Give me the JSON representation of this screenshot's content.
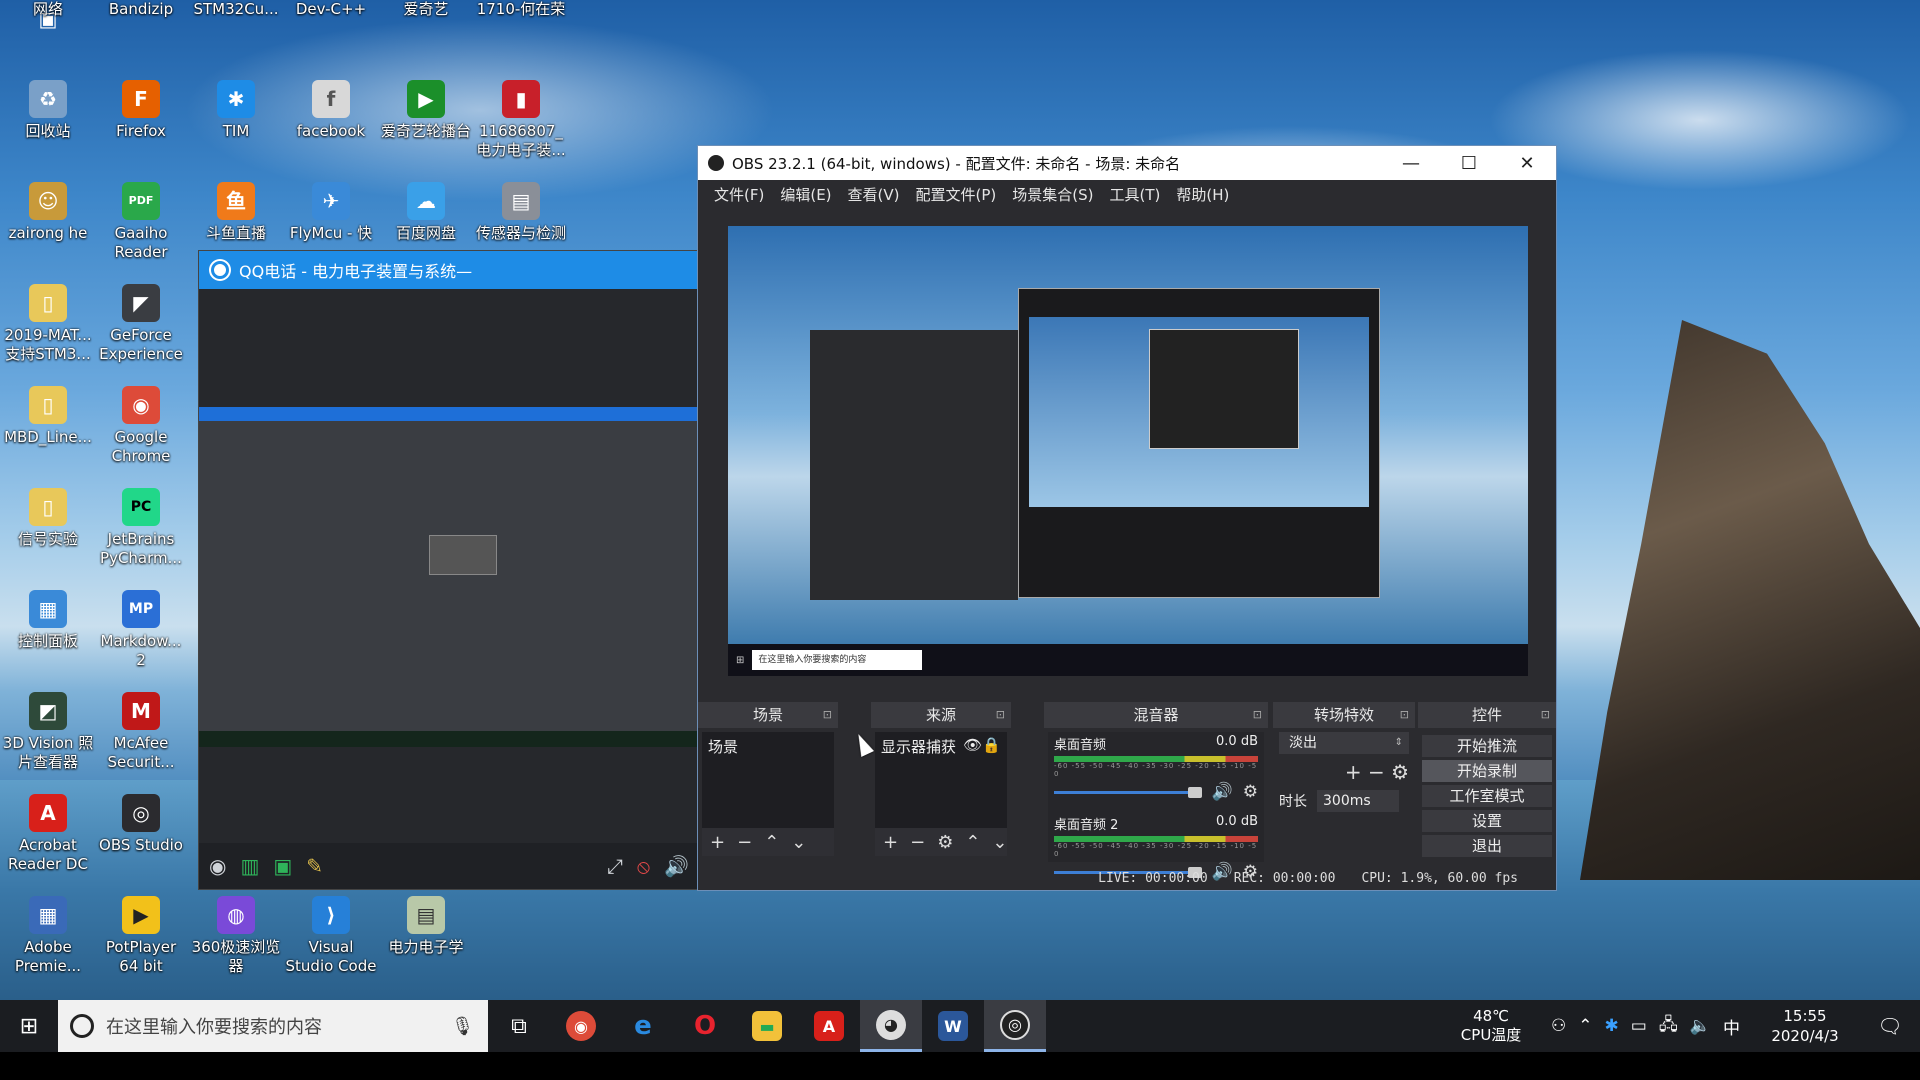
{
  "desktop": {
    "icons": [
      {
        "label": "网络",
        "glyph": "▣",
        "color": "#3a7bd5"
      },
      {
        "label": "Bandizip",
        "glyph": "B",
        "color": "#2f80ed"
      },
      {
        "label": "STM32Cu...",
        "glyph": "S",
        "color": "#2f5fa8"
      },
      {
        "label": "Dev-C++",
        "glyph": "C",
        "color": "#2a55a5"
      },
      {
        "label": "爱奇艺",
        "glyph": "爱",
        "color": "#2fb43a"
      },
      {
        "label": "1710-何在荣",
        "glyph": "W",
        "color": "#2b579a"
      },
      {
        "label": "回收站",
        "glyph": "♻",
        "color": "#7aa0c8"
      },
      {
        "label": "Firefox",
        "glyph": "F",
        "color": "#e66000"
      },
      {
        "label": "TIM",
        "glyph": "✱",
        "color": "#1e8ce6"
      },
      {
        "label": "facebook",
        "glyph": "f",
        "color": "#d8d8d8"
      },
      {
        "label": "爱奇艺轮播台",
        "glyph": "▶",
        "color": "#1b8f2a"
      },
      {
        "label": "11686807_电力电子装...",
        "glyph": "▮",
        "color": "#c8202a"
      },
      {
        "label": "zairong he",
        "glyph": "☺",
        "color": "#c89a3a"
      },
      {
        "label": "Gaaiho Reader",
        "glyph": "PDF",
        "color": "#2aa84a"
      },
      {
        "label": "斗鱼直播",
        "glyph": "鱼",
        "color": "#f07a1a"
      },
      {
        "label": "FlyMcu - 快",
        "glyph": "✈",
        "color": "#3a8ad8"
      },
      {
        "label": "百度网盘",
        "glyph": "☁",
        "color": "#3aa0e8"
      },
      {
        "label": "传感器与检测",
        "glyph": "▤",
        "color": "#8a8f98"
      },
      {
        "label": "2019-MAT... 支持STM3...",
        "glyph": "▯",
        "color": "#e8c85a"
      },
      {
        "label": "GeForce Experience",
        "glyph": "◤",
        "color": "#3a3d42"
      },
      {
        "label": "MBD_Line...",
        "glyph": "▯",
        "color": "#e8c85a"
      },
      {
        "label": "Google Chrome",
        "glyph": "◉",
        "color": "#dd4b39"
      },
      {
        "label": "信号实验",
        "glyph": "▯",
        "color": "#e8c85a"
      },
      {
        "label": "JetBrains PyCharm...",
        "glyph": "PC",
        "color": "#21d789"
      },
      {
        "label": "控制面板",
        "glyph": "▦",
        "color": "#3a8ad8"
      },
      {
        "label": "Markdow... 2",
        "glyph": "MP",
        "color": "#2b6fd6"
      },
      {
        "label": "3D Vision 照片查看器",
        "glyph": "◩",
        "color": "#2e4a3a"
      },
      {
        "label": "McAfee Securit...",
        "glyph": "M",
        "color": "#c01818"
      },
      {
        "label": "Acrobat Reader DC",
        "glyph": "A",
        "color": "#d8201a"
      },
      {
        "label": "OBS Studio",
        "glyph": "◎",
        "color": "#2b2b2f"
      },
      {
        "label": "Adobe Premie...",
        "glyph": "▦",
        "color": "#3a6ab8"
      },
      {
        "label": "PotPlayer 64 bit",
        "glyph": "▶",
        "color": "#f2c11a"
      },
      {
        "label": "360极速浏览器",
        "glyph": "◍",
        "color": "#7a4ad8"
      },
      {
        "label": "Visual Studio Code",
        "glyph": "⟩",
        "color": "#2680d8"
      },
      {
        "label": "电力电子学",
        "glyph": "▤",
        "color": "#b8c8a8"
      }
    ]
  },
  "qq_window": {
    "title": "QQ电话 - 电力电子装置与系统—"
  },
  "obs": {
    "title": "OBS 23.2.1 (64-bit, windows) - 配置文件: 未命名 - 场景: 未命名",
    "menu": [
      "文件(F)",
      "编辑(E)",
      "查看(V)",
      "配置文件(P)",
      "场景集合(S)",
      "工具(T)",
      "帮助(H)"
    ],
    "preview_search": "在这里输入你要搜索的内容",
    "docks": {
      "scenes": {
        "title": "场景",
        "item": "场景"
      },
      "sources": {
        "title": "来源",
        "item": "显示器捕获"
      },
      "mixer": {
        "title": "混音器",
        "channels": [
          {
            "name": "桌面音频",
            "db": "0.0 dB",
            "scale": "-60 -55 -50 -45 -40 -35 -30 -25 -20 -15 -10 -5 0"
          },
          {
            "name": "桌面音频 2",
            "db": "0.0 dB",
            "scale": "-60 -55 -50 -45 -40 -35 -30 -25 -20 -15 -10 -5 0"
          }
        ]
      },
      "transitions": {
        "title": "转场特效",
        "selected": "淡出",
        "duration_label": "时长",
        "duration": "300ms"
      },
      "controls": {
        "title": "控件",
        "buttons": [
          "开始推流",
          "开始录制",
          "工作室模式",
          "设置",
          "退出"
        ]
      }
    },
    "status": {
      "live": "LIVE: 00:00:00",
      "rec": "REC: 00:00:00",
      "cpu": "CPU: 1.9%, 60.00 fps"
    }
  },
  "taskbar": {
    "search_placeholder": "在这里输入你要搜索的内容",
    "temp": "48℃",
    "temp_label": "CPU温度",
    "ime": "中",
    "time": "15:55",
    "date": "2020/4/3"
  }
}
